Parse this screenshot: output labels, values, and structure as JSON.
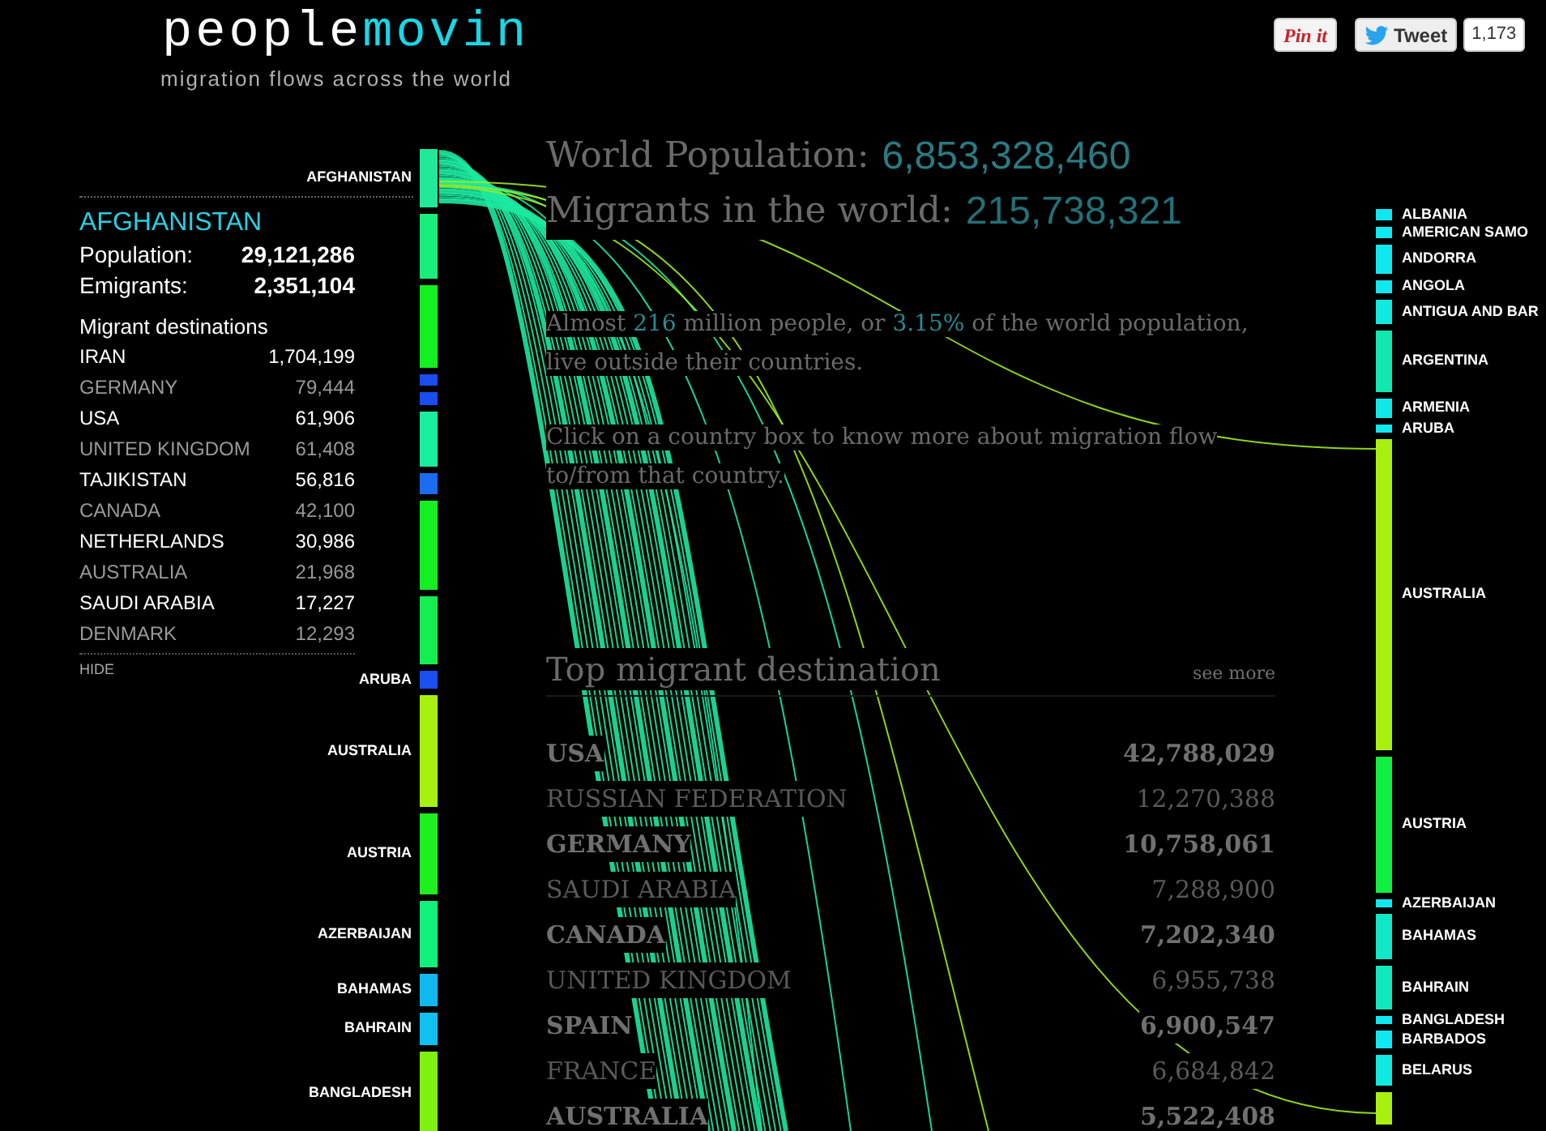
{
  "header": {
    "logo_part_1": "people",
    "logo_part_2": "movin",
    "tagline": "migration flows across the world"
  },
  "share": {
    "pin_label": "Pin it",
    "tweet_label": "Tweet",
    "tweet_count": "1,173"
  },
  "summary": {
    "world_population_label": "World Population:",
    "world_population": "6,853,328,460",
    "migrants_label": "Migrants in the world:",
    "migrants": "215,738,321",
    "paragraphs": [
      [
        {
          "text": "Almost ",
          "highlight": false
        },
        {
          "text": "216",
          "highlight": true
        },
        {
          "text": " million people, or ",
          "highlight": false
        },
        {
          "text": "3.15%",
          "highlight": true
        },
        {
          "text": " of the world population, live outside their countries.",
          "highlight": false
        }
      ],
      [
        {
          "text": "Click on a country box to know more about migration flow to/from that country.",
          "highlight": false
        }
      ]
    ]
  },
  "top_destinations": {
    "title": "Top migrant destination",
    "see_more": "see more",
    "rows": [
      {
        "country": "USA",
        "count": "42,788,029"
      },
      {
        "country": "RUSSIAN FEDERATION",
        "count": "12,270,388"
      },
      {
        "country": "GERMANY",
        "count": "10,758,061"
      },
      {
        "country": "SAUDI ARABIA",
        "count": "7,288,900"
      },
      {
        "country": "CANADA",
        "count": "7,202,340"
      },
      {
        "country": "UNITED KINGDOM",
        "count": "6,955,738"
      },
      {
        "country": "SPAIN",
        "count": "6,900,547"
      },
      {
        "country": "FRANCE",
        "count": "6,684,842"
      },
      {
        "country": "AUSTRALIA",
        "count": "5,522,408"
      }
    ]
  },
  "origin_countries": [
    {
      "label": "AFGHANISTAN",
      "color": "#22e89a"
    },
    {
      "color": "#19ee7a"
    },
    {
      "color": "#12f020"
    },
    {
      "color": "#1a4cf0"
    },
    {
      "color": "#1a4ef0"
    },
    {
      "color": "#19eea0"
    },
    {
      "color": "#1a6cf0"
    },
    {
      "color": "#14ef24"
    },
    {
      "color": "#14ee50"
    },
    {
      "label": "ARUBA",
      "color": "#1a50f0"
    },
    {
      "label": "AUSTRALIA",
      "color": "#a8f010"
    },
    {
      "label": "AUSTRIA",
      "color": "#1ef020"
    },
    {
      "label": "AZERBAIJAN",
      "color": "#10f07a"
    },
    {
      "label": "BAHAMAS",
      "color": "#10b8f0"
    },
    {
      "label": "BAHRAIN",
      "color": "#10c0f0"
    },
    {
      "label": "BANGLADESH",
      "color": "#80f010"
    }
  ],
  "country_panel": {
    "name": "AFGHANISTAN",
    "population_label": "Population:",
    "population": "29,121,286",
    "emigrants_label": "Emigrants:",
    "emigrants": "2,351,104",
    "destinations_title": "Migrant destinations",
    "destinations": [
      {
        "country": "IRAN",
        "count": "1,704,199"
      },
      {
        "country": "GERMANY",
        "count": "79,444"
      },
      {
        "country": "USA",
        "count": "61,906"
      },
      {
        "country": "UNITED KINGDOM",
        "count": "61,408"
      },
      {
        "country": "TAJIKISTAN",
        "count": "56,816"
      },
      {
        "country": "CANADA",
        "count": "42,100"
      },
      {
        "country": "NETHERLANDS",
        "count": "30,986"
      },
      {
        "country": "AUSTRALIA",
        "count": "21,968"
      },
      {
        "country": "SAUDI ARABIA",
        "count": "17,227"
      },
      {
        "country": "DENMARK",
        "count": "12,293"
      }
    ],
    "hide_link": "HIDE"
  },
  "destination_countries": [
    {
      "label": "ALBANIA",
      "color": "#10e8f0"
    },
    {
      "label": "AMERICAN SAMO",
      "color": "#10e8f0"
    },
    {
      "label": "ANDORRA",
      "color": "#10e8f0"
    },
    {
      "label": "ANGOLA",
      "color": "#10e8f0"
    },
    {
      "label": "ANTIGUA AND BAR",
      "color": "#10e8e0"
    },
    {
      "label": "ARGENTINA",
      "color": "#10e8b0"
    },
    {
      "label": "ARMENIA",
      "color": "#10e8e8"
    },
    {
      "label": "ARUBA",
      "color": "#10e8f0"
    },
    {
      "label": "AUSTRALIA",
      "color": "#a8f010"
    },
    {
      "label": "AUSTRIA",
      "color": "#10f040"
    },
    {
      "label": "AZERBAIJAN",
      "color": "#10e8f0"
    },
    {
      "label": "BAHAMAS",
      "color": "#10e8c8"
    },
    {
      "label": "BAHRAIN",
      "color": "#10e8c0"
    },
    {
      "label": "BANGLADESH",
      "color": "#10e8f0"
    },
    {
      "label": "BARBADOS",
      "color": "#10e8f0"
    },
    {
      "label": "BELARUS",
      "color": "#10e8e0"
    },
    {
      "color": "#a8f010"
    }
  ]
}
